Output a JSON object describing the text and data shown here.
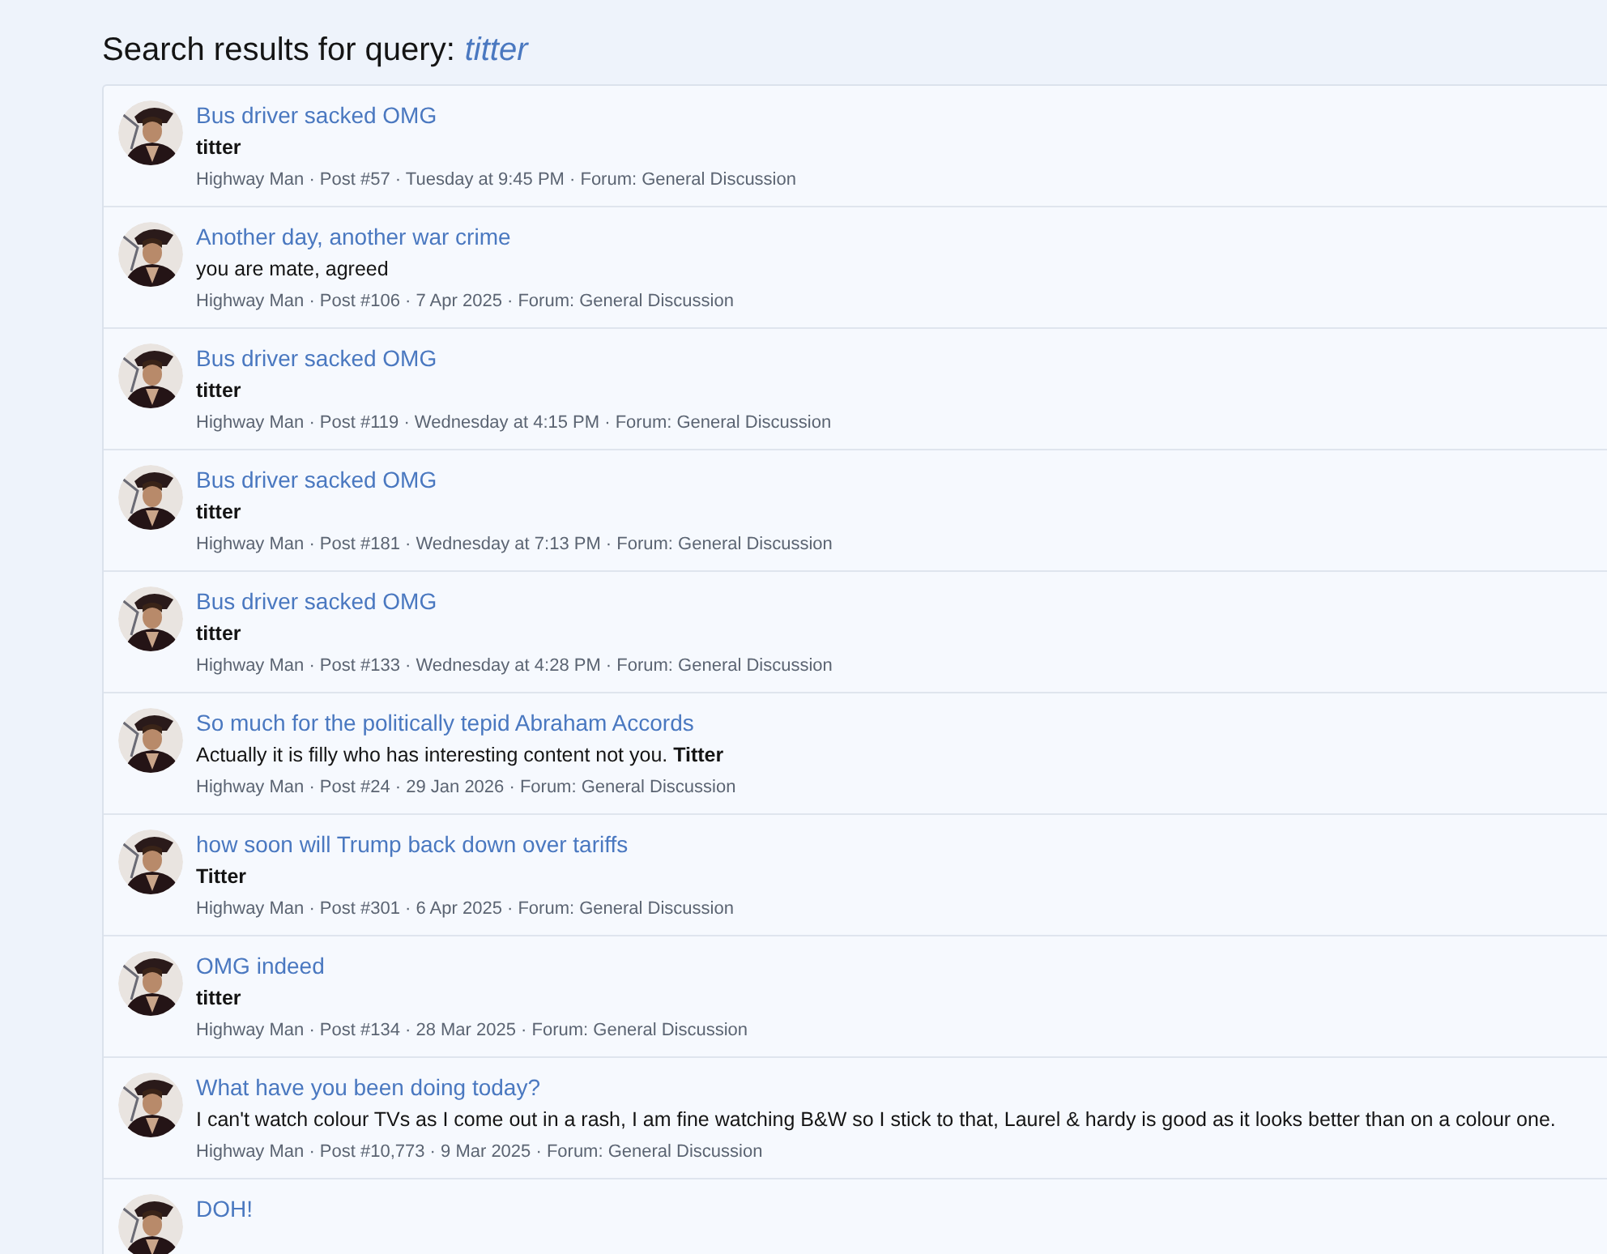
{
  "heading": {
    "label": "Search results for query:",
    "query": "titter"
  },
  "results": [
    {
      "title": "Bus driver sacked OMG",
      "body": "titter",
      "body_bold": true,
      "meta": "Highway Man · Post #57 · Tuesday at 9:45 PM · Forum: General Discussion"
    },
    {
      "title": "Another day, another war crime",
      "body": "you are mate, agreed",
      "body_bold": false,
      "meta": "Highway Man · Post #106 · 7 Apr 2025 · Forum: General Discussion"
    },
    {
      "title": "Bus driver sacked OMG",
      "body": "titter",
      "body_bold": true,
      "meta": "Highway Man · Post #119 · Wednesday at 4:15 PM · Forum: General Discussion"
    },
    {
      "title": "Bus driver sacked OMG",
      "body": "titter",
      "body_bold": true,
      "meta": "Highway Man · Post #181 · Wednesday at 7:13 PM · Forum: General Discussion"
    },
    {
      "title": "Bus driver sacked OMG",
      "body": "titter",
      "body_bold": true,
      "meta": "Highway Man · Post #133 · Wednesday at 4:28 PM · Forum: General Discussion"
    },
    {
      "title": "So much for the politically tepid Abraham Accords",
      "body": "Actually it is filly who has interesting content not you. **Titter**",
      "body_bold": false,
      "meta": "Highway Man · Post #24 · 29 Jan 2026 · Forum: General Discussion"
    },
    {
      "title": "how soon will Trump back down over tariffs",
      "body": "Titter",
      "body_bold": true,
      "meta": "Highway Man · Post #301 · 6 Apr 2025 · Forum: General Discussion"
    },
    {
      "title": "OMG indeed",
      "body": "titter",
      "body_bold": true,
      "meta": "Highway Man · Post #134 · 28 Mar 2025 · Forum: General Discussion"
    },
    {
      "title": "What have you been doing today?",
      "body": "I can't watch colour TVs as I come out in a rash, I am fine watching B&W so I stick to that, Laurel & hardy is good as it looks better than on a colour one.",
      "body_bold": false,
      "meta": "Highway Man · Post #10,773 · 9 Mar 2025 · Forum: General Discussion"
    },
    {
      "title": "DOH!"
    }
  ]
}
